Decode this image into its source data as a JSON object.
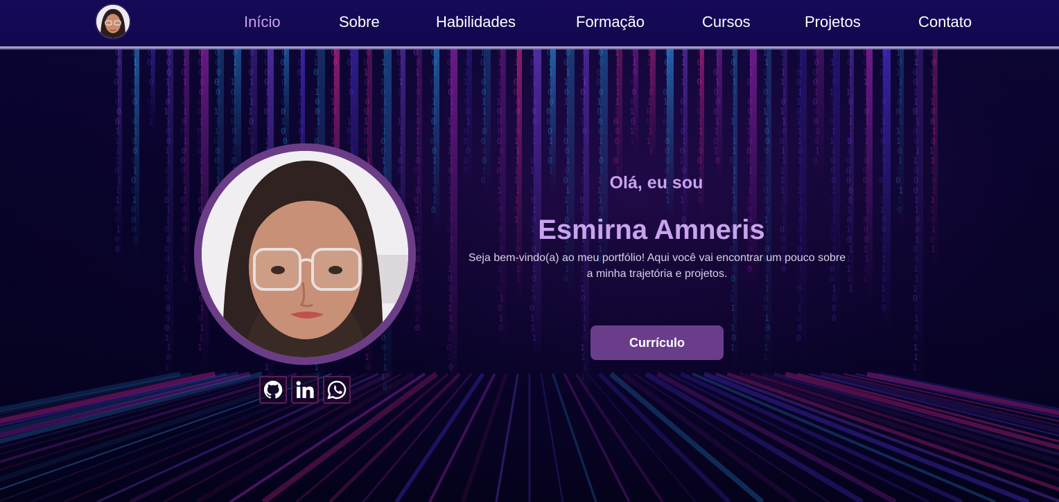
{
  "nav": {
    "links": [
      {
        "label": "Início",
        "active": true
      },
      {
        "label": "Sobre"
      },
      {
        "label": "Habilidades"
      },
      {
        "label": "Formação"
      },
      {
        "label": "Cursos"
      },
      {
        "label": "Projetos"
      },
      {
        "label": "Contato"
      }
    ]
  },
  "hero": {
    "greeting": "Olá, eu sou",
    "name": "Esmirna Amneris",
    "intro": "Seja bem-vindo(a) ao meu portfólio! Aqui você vai encontrar um pouco sobre a minha trajetória e projetos.",
    "cv_button": "Currículo"
  },
  "socials": [
    {
      "icon": "github-icon"
    },
    {
      "icon": "linkedin-icon"
    },
    {
      "icon": "whatsapp-icon"
    }
  ],
  "colors": {
    "accent": "#c9a3ee",
    "button": "#6a3d8a",
    "ring": "#6b3d87",
    "navbar": "#160a5a"
  }
}
